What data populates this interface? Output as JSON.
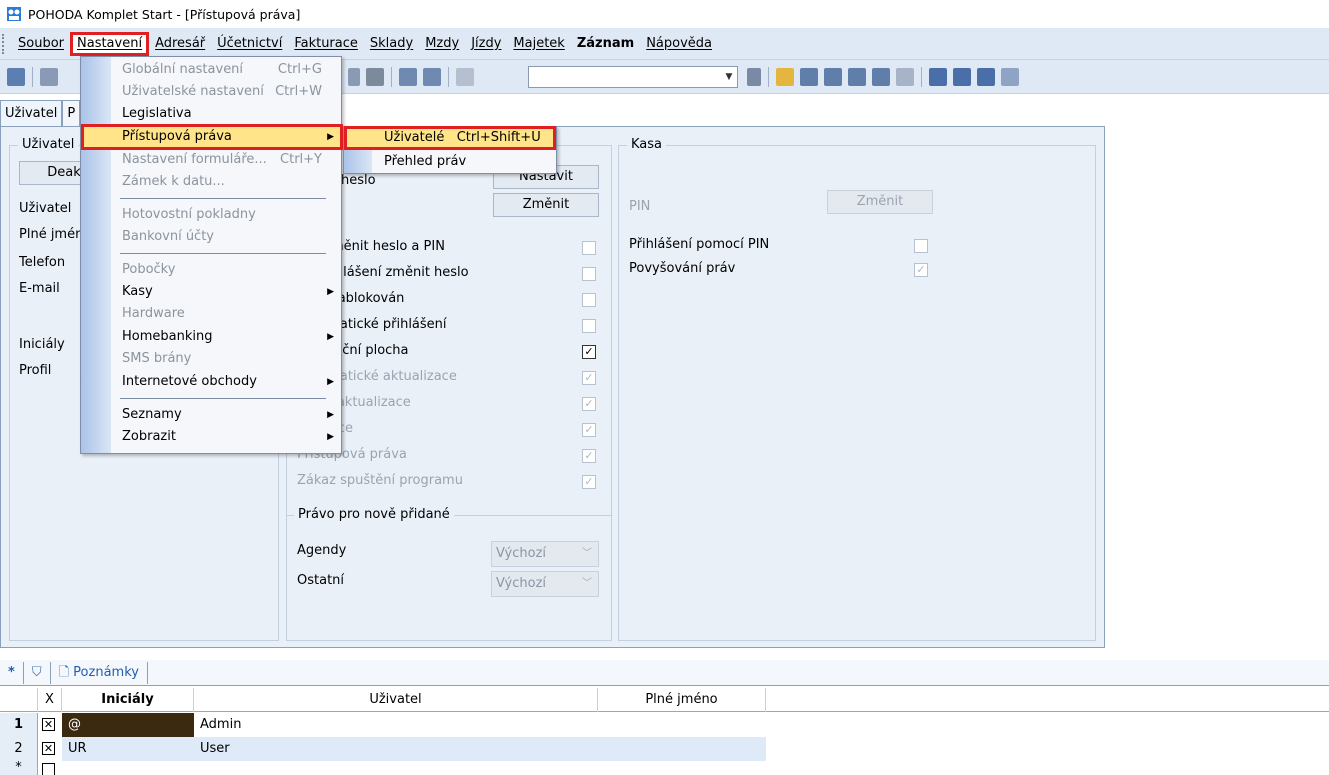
{
  "window": {
    "title": "POHODA Komplet Start - [Přístupová práva]"
  },
  "menubar": {
    "items": [
      "Soubor",
      "Nastavení",
      "Adresář",
      "Účetnictví",
      "Fakturace",
      "Sklady",
      "Mzdy",
      "Jízdy",
      "Majetek",
      "Záznam",
      "Nápověda"
    ],
    "active": "Nastavení"
  },
  "tabs": [
    "Uživatel",
    "P"
  ],
  "left_panel": {
    "group_title": "Uživatel",
    "deactivate_button": "Deak",
    "labels": [
      "Uživatel",
      "Plné jméno",
      "Telefon",
      "E-mail",
      "Iniciály",
      "Profil"
    ]
  },
  "middle_panel": {
    "password_label": "heslo",
    "set_button": "Nastavit",
    "change_button": "Změnit",
    "options": [
      {
        "label": "Musí měnit heslo a PIN",
        "checked": false,
        "enabled": true
      },
      {
        "label": "Při přihlášení změnit heslo",
        "checked": false,
        "enabled": true
      },
      {
        "label": "Účet zablokován",
        "checked": false,
        "enabled": true
      },
      {
        "label": "Automatické přihlášení",
        "checked": false,
        "enabled": true
      },
      {
        "label": "Navigační plocha",
        "checked": true,
        "enabled": true
      },
      {
        "label": "Automatické aktualizace",
        "checked": true,
        "enabled": false
      },
      {
        "label": "Ruční aktualizace",
        "checked": true,
        "enabled": false
      },
      {
        "label": "Aktivace",
        "checked": true,
        "enabled": false
      },
      {
        "label": "Přístupová práva",
        "checked": true,
        "enabled": false
      },
      {
        "label": "Zákaz spuštění programu",
        "checked": true,
        "enabled": false
      }
    ],
    "new_rights_title": "Právo pro nově přidané",
    "agendy_label": "Agendy",
    "agendy_value": "Výchozí",
    "ostatni_label": "Ostatní",
    "ostatni_value": "Výchozí"
  },
  "kasa_panel": {
    "title": "Kasa",
    "pin_label": "PIN",
    "pin_button": "Změnit",
    "pin_login_label": "Přihlášení pomocí PIN",
    "pin_login_checked": false,
    "elevation_label": "Povyšování práv",
    "elevation_checked": true
  },
  "dropdown": {
    "items": [
      {
        "label": "Globální nastavení",
        "shortcut": "Ctrl+G",
        "dim": true
      },
      {
        "label": "Uživatelské nastavení",
        "shortcut": "Ctrl+W",
        "dim": true
      },
      {
        "label": "Legislativa",
        "shortcut": "",
        "dim": false
      },
      {
        "label": "Přístupová práva",
        "shortcut": "",
        "dim": false,
        "submenu": true,
        "highlighted": true
      },
      {
        "label": "Nastavení formuláře...",
        "shortcut": "Ctrl+Y",
        "dim": true
      },
      {
        "label": "Zámek k datu...",
        "shortcut": "",
        "dim": true
      },
      {
        "label": "Hotovostní pokladny",
        "shortcut": "",
        "dim": true
      },
      {
        "label": "Bankovní účty",
        "shortcut": "",
        "dim": true
      },
      {
        "label": "Pobočky",
        "shortcut": "",
        "dim": true
      },
      {
        "label": "Kasy",
        "shortcut": "",
        "dim": false,
        "submenu": true
      },
      {
        "label": "Hardware",
        "shortcut": "",
        "dim": true
      },
      {
        "label": "Homebanking",
        "shortcut": "",
        "dim": false,
        "submenu": true
      },
      {
        "label": "SMS brány",
        "shortcut": "",
        "dim": true
      },
      {
        "label": "Internetové obchody",
        "shortcut": "",
        "dim": false,
        "submenu": true
      },
      {
        "label": "Seznamy",
        "shortcut": "",
        "dim": false,
        "submenu": true
      },
      {
        "label": "Zobrazit",
        "shortcut": "",
        "dim": false,
        "submenu": true
      }
    ]
  },
  "submenu": {
    "items": [
      {
        "label": "Uživatelé",
        "shortcut": "Ctrl+Shift+U",
        "highlighted": true
      },
      {
        "label": "Přehled práv",
        "shortcut": ""
      }
    ]
  },
  "bottom": {
    "tabs": [
      "*",
      "Poznámky"
    ],
    "columns": [
      "X",
      "Iniciály",
      "Uživatel",
      "Plné jméno"
    ],
    "rows": [
      {
        "num": "1",
        "x": "☒",
        "initials": "@",
        "user": "Admin",
        "fullname": ""
      },
      {
        "num": "2",
        "x": "☒",
        "initials": "UR",
        "user": "User",
        "fullname": ""
      },
      {
        "num": "*",
        "x": "",
        "initials": "",
        "user": "",
        "fullname": ""
      }
    ]
  },
  "colors": {
    "highlight_border": "#e02020",
    "highlight_fill": "#ffe48a",
    "selected_row": "#3b2a10"
  }
}
